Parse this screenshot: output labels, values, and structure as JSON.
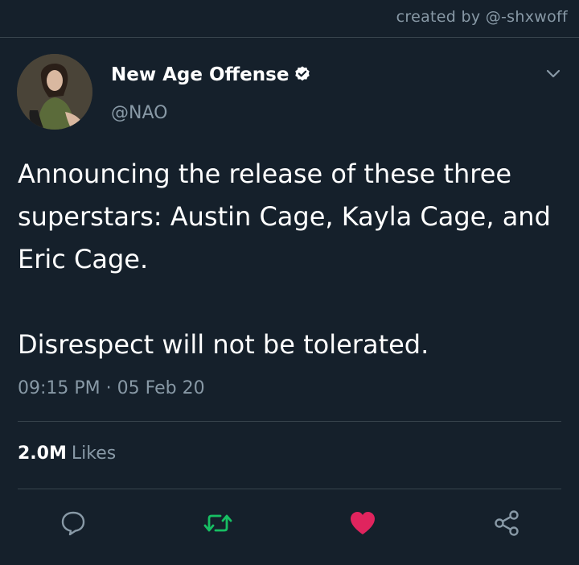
{
  "watermark": "created by @-shxwoff",
  "author": {
    "name": "New Age Offense",
    "handle": "@NAO",
    "verified": true
  },
  "tweet": {
    "paragraphs": [
      "Announcing the release of these three superstars: Austin Cage, Kayla Cage, and Eric Cage.",
      "Disrespect will not be tolerated."
    ],
    "time": "09:15 PM",
    "separator": "·",
    "date": "05 Feb 20"
  },
  "stats": {
    "likes_count": "2.0M",
    "likes_label": "Likes"
  },
  "actions": [
    {
      "name": "reply",
      "icon": "comment-icon"
    },
    {
      "name": "retweet",
      "icon": "retweet-icon",
      "color": "#17bf63"
    },
    {
      "name": "like",
      "icon": "heart-icon",
      "color": "#e0245e",
      "active": true
    },
    {
      "name": "share",
      "icon": "share-icon"
    }
  ],
  "colors": {
    "background": "#15202b",
    "text": "#ffffff",
    "secondary_text": "#8899a6",
    "divider": "#38444d",
    "retweet": "#17bf63",
    "like": "#e0245e"
  }
}
